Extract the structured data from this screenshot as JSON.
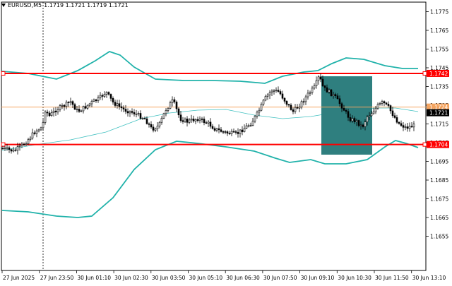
{
  "header": {
    "symbol": "EURUSD,M5",
    "quotes": "1.1719 1.1721 1.1719 1.1721"
  },
  "price_axis": {
    "labels": [
      "1.1775",
      "1.1765",
      "1.1755",
      "1.1745",
      "1.1735",
      "1.1725",
      "1.1715",
      "1.1705",
      "1.1695",
      "1.1685",
      "1.1675",
      "1.1665",
      "1.1655"
    ]
  },
  "time_axis": {
    "labels": [
      "27 Jun 2025",
      "27 Jun 23:50",
      "30 Jun 01:10",
      "30 Jun 02:30",
      "30 Jun 03:50",
      "30 Jun 05:10",
      "30 Jun 06:30",
      "30 Jun 07:50",
      "30 Jun 09:10",
      "30 Jun 10:30",
      "30 Jun 11:50",
      "30 Jun 13:10"
    ]
  },
  "levels": [
    {
      "label": "1.1742",
      "color": "#ff0000"
    },
    {
      "label": "1.1724",
      "color": "#f4a460"
    },
    {
      "label": "1.1721",
      "color": "#000000"
    },
    {
      "label": "1.1704",
      "color": "#ff0000"
    }
  ],
  "colors": {
    "bollinger": "#20b2aa",
    "ma": "#40c0c0",
    "candle": "#000000",
    "zone": "#2f7f7f"
  },
  "chart_data": {
    "type": "candlestick",
    "symbol": "EURUSD",
    "timeframe": "M5",
    "ylim": [
      1.165,
      1.178
    ],
    "horizontal_levels": [
      1.1742,
      1.1724,
      1.1704
    ],
    "last_price": 1.1721,
    "highlight_zone": {
      "price_top": 1.1745,
      "price_bottom": 1.1706
    }
  }
}
